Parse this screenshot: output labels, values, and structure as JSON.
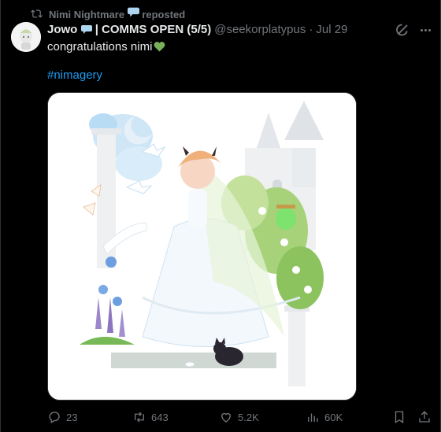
{
  "repost": {
    "reposter": "Nimi Nightmare",
    "label": "reposted"
  },
  "tweet": {
    "display_name": "Jowo",
    "name_suffix": " | COMMS OPEN (5/5)",
    "handle": "@seekorplatypus",
    "separator": "·",
    "date": "Jul 29",
    "text": "congratulations nimi",
    "hashtag": "#nimagery"
  },
  "metrics": {
    "replies": "23",
    "reposts": "643",
    "likes": "5.2K",
    "views": "60K"
  },
  "colors": {
    "background": "#000000",
    "text_primary": "#e7e9ea",
    "text_secondary": "#71767b",
    "link": "#1d9bf0",
    "heart_emoji": "#78b159",
    "bubble_emoji": "#aed6f1"
  },
  "icons": {
    "repost": "repost-icon",
    "grok": "grok-icon",
    "more": "more-icon",
    "reply": "reply-icon",
    "retweet": "retweet-icon",
    "like": "heart-icon",
    "views": "views-icon",
    "bookmark": "bookmark-icon",
    "share": "share-icon"
  }
}
